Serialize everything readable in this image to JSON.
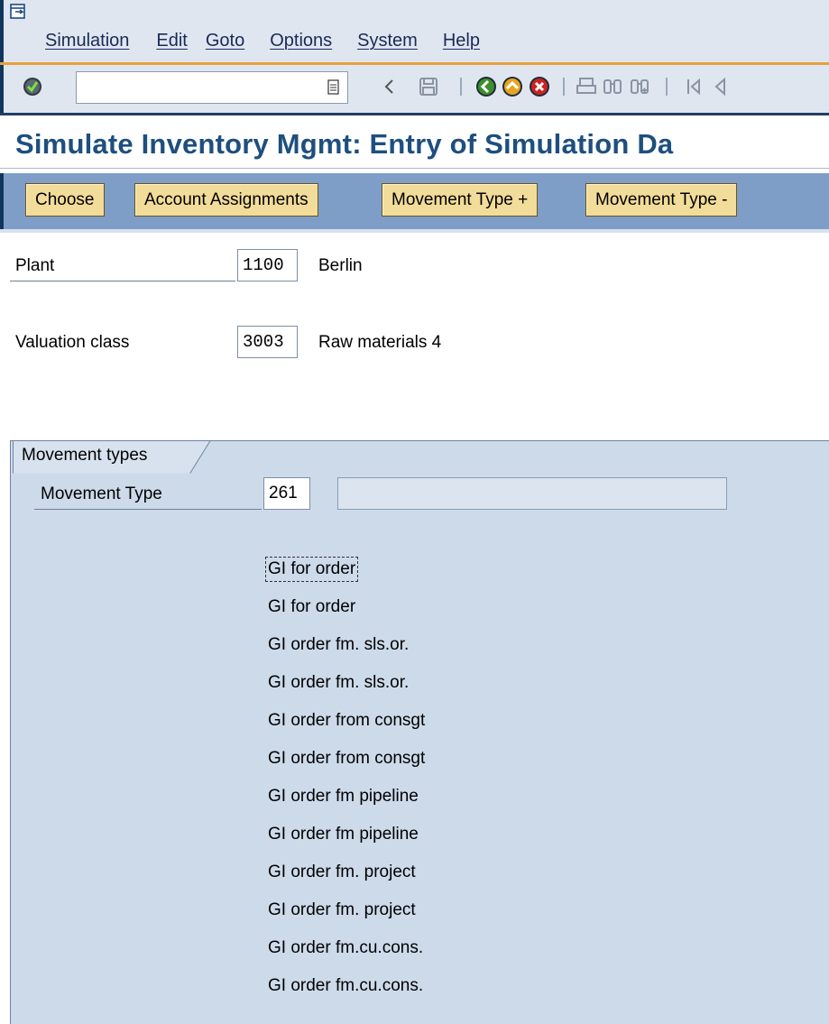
{
  "menubar": {
    "items": [
      {
        "label": "Simulation"
      },
      {
        "label": "Edit"
      },
      {
        "label": "Goto"
      },
      {
        "label": "Options"
      },
      {
        "label": "System"
      },
      {
        "label": "Help"
      }
    ]
  },
  "toolbar": {
    "command_value": ""
  },
  "page": {
    "title": "Simulate Inventory Mgmt: Entry of Simulation Da"
  },
  "app_toolbar": {
    "buttons": [
      "Choose",
      "Account Assignments",
      "Movement Type +",
      "Movement Type -"
    ]
  },
  "fields": {
    "plant": {
      "label": "Plant",
      "value": "1100",
      "text": "Berlin"
    },
    "valuation_class": {
      "label": "Valuation class",
      "value": "3003",
      "text": "Raw materials 4"
    }
  },
  "movement_group": {
    "title": "Movement types",
    "movement_type_label": "Movement Type",
    "movement_type_value": "261",
    "description_value": "",
    "items": [
      "GI for order",
      "GI for order",
      "GI order fm. sls.or.",
      "GI order fm. sls.or.",
      "GI order from consgt",
      "GI order from consgt",
      "GI order fm pipeline",
      "GI order fm pipeline",
      "GI order fm. project",
      "GI order fm. project",
      "GI order fm.cu.cons.",
      "GI order fm.cu.cons."
    ]
  },
  "colors": {
    "title": "#1d4f7f",
    "menu_bg": "#dfe6f0",
    "accent_line": "#e8a03c",
    "app_toolbar_bg": "#7e9ec8",
    "button_bg": "#f2dc9a",
    "group_bg": "#cddaea"
  }
}
